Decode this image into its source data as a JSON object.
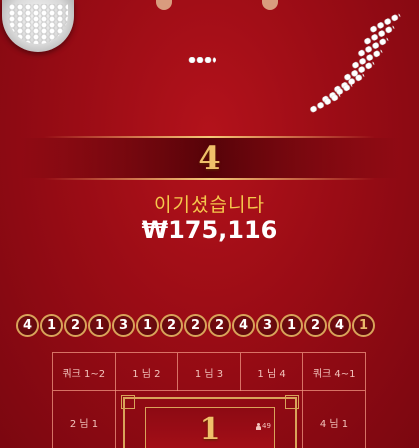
{
  "result": {
    "number": "4",
    "message": "이기셨습니다",
    "payout": "₩175,116"
  },
  "history": [
    "4",
    "1",
    "2",
    "1",
    "3",
    "1",
    "2",
    "2",
    "2",
    "4",
    "3",
    "1",
    "2",
    "4",
    "1"
  ],
  "board": {
    "top_bets": [
      "쿼크 1~2",
      "1 님 2",
      "1 님 3",
      "1 님 4",
      "쿼크 4~1"
    ],
    "left_bet": "2 님 1",
    "right_bet": "4 님 1",
    "center_number": "1",
    "center_players": "49"
  },
  "colors": {
    "felt": "#9a0c15",
    "gold": "#f0c06a",
    "win_text": "#f5c84c"
  },
  "icons": [
    "chip-bowl-icon",
    "person-icon"
  ]
}
